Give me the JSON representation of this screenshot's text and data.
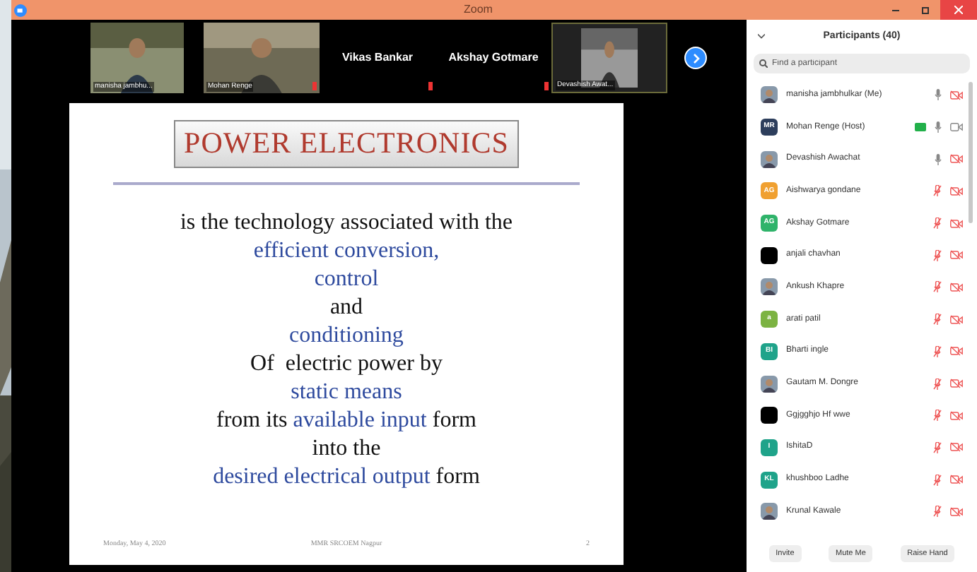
{
  "window": {
    "title": "Zoom"
  },
  "video_strip": [
    {
      "name": "manisha jambhu...",
      "kind": "picture",
      "muted": false,
      "active": false
    },
    {
      "name": "Mohan Renge",
      "kind": "picture",
      "muted": true,
      "active": false
    },
    {
      "name": "Vikas Bankar",
      "kind": "name",
      "muted": true,
      "active": false
    },
    {
      "name": "Akshay Gotmare",
      "kind": "name",
      "muted": true,
      "active": false
    },
    {
      "name": "Devashish Awat...",
      "kind": "picture",
      "muted": false,
      "active": true
    }
  ],
  "slide": {
    "title": "POWER ELECTRONICS",
    "lines": [
      [
        {
          "text": "is the technology associated with the",
          "highlight": false
        }
      ],
      [
        {
          "text": "efficient conversion,",
          "highlight": true
        }
      ],
      [
        {
          "text": "control",
          "highlight": true
        }
      ],
      [
        {
          "text": "and",
          "highlight": false
        }
      ],
      [
        {
          "text": "conditioning",
          "highlight": true
        }
      ],
      [
        {
          "text": "Of  electric power by",
          "highlight": false
        }
      ],
      [
        {
          "text": "static means",
          "highlight": true
        }
      ],
      [
        {
          "text": "from its ",
          "highlight": false
        },
        {
          "text": "available input",
          "highlight": true
        },
        {
          "text": " form",
          "highlight": false
        }
      ],
      [
        {
          "text": "into the",
          "highlight": false
        }
      ],
      [
        {
          "text": "desired electrical output",
          "highlight": true
        },
        {
          "text": " form",
          "highlight": false
        }
      ]
    ],
    "footer": {
      "date": "Monday, May 4, 2020",
      "org": "MMR SRCOEM Nagpur",
      "page": "2"
    }
  },
  "participants": {
    "title": "Participants (40)",
    "search": {
      "placeholder": "Find a participant"
    },
    "items": [
      {
        "name": "manisha jambhulkar (Me)",
        "kind": "picture",
        "muted": false,
        "video": false,
        "sharing": false
      },
      {
        "name": "Mohan Renge (Host)",
        "kind": "initials",
        "initials": "MR",
        "color": "#2d3e5c",
        "muted": false,
        "video": true,
        "sharing": true
      },
      {
        "name": "Devashish Awachat",
        "kind": "picture",
        "muted": false,
        "video": false,
        "sharing": false
      },
      {
        "name": "Aishwarya gondane",
        "kind": "initials",
        "initials": "AG",
        "color": "#f0a030",
        "muted": true,
        "video": false,
        "sharing": false
      },
      {
        "name": "Akshay Gotmare",
        "kind": "initials",
        "initials": "AG",
        "color": "#2fb36a",
        "muted": true,
        "video": false,
        "sharing": false
      },
      {
        "name": "anjali chavhan",
        "kind": "blank",
        "muted": true,
        "video": false,
        "sharing": false
      },
      {
        "name": "Ankush Khapre",
        "kind": "picture",
        "muted": true,
        "video": false,
        "sharing": false
      },
      {
        "name": "arati patil",
        "kind": "initials",
        "initials": "a",
        "color": "#7cb342",
        "muted": true,
        "video": false,
        "sharing": false
      },
      {
        "name": "Bharti ingle",
        "kind": "initials",
        "initials": "BI",
        "color": "#1fa38a",
        "muted": true,
        "video": false,
        "sharing": false
      },
      {
        "name": "Gautam M. Dongre",
        "kind": "picture",
        "muted": true,
        "video": false,
        "sharing": false
      },
      {
        "name": "Ggjgghjo Hf wwe",
        "kind": "blank",
        "muted": true,
        "video": false,
        "sharing": false
      },
      {
        "name": "IshitaD",
        "kind": "initials",
        "initials": "I",
        "color": "#1fa38a",
        "muted": true,
        "video": false,
        "sharing": false
      },
      {
        "name": "khushboo Ladhe",
        "kind": "initials",
        "initials": "KL",
        "color": "#1fa38a",
        "muted": true,
        "video": false,
        "sharing": false
      },
      {
        "name": "Krunal Kawale",
        "kind": "picture",
        "muted": true,
        "video": false,
        "sharing": false
      }
    ],
    "buttons": [
      "Invite",
      "Mute Me",
      "Raise Hand"
    ]
  }
}
